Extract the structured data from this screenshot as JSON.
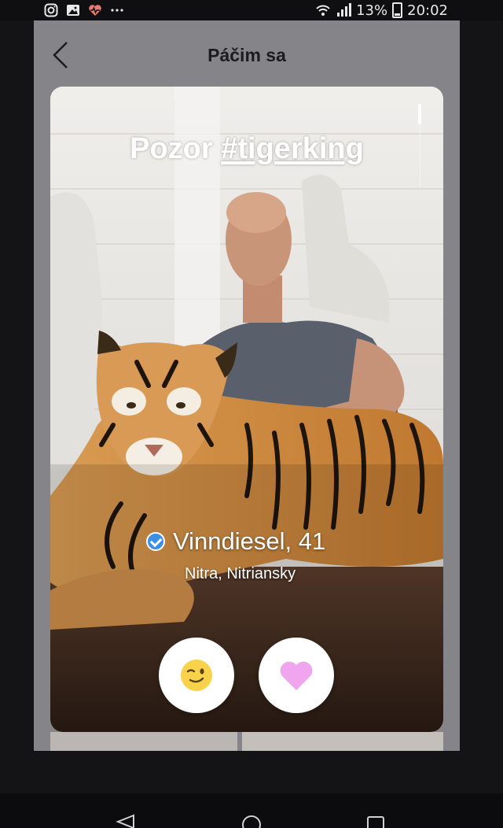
{
  "status_bar": {
    "left_icons": [
      "instagram-icon",
      "gallery-icon",
      "health-heart-icon",
      "more-dots-icon"
    ],
    "battery": "13%",
    "time": "20:02"
  },
  "header": {
    "back_icon": "chevron-left-icon",
    "title": "Páčim sa"
  },
  "profile_card": {
    "caption_prefix": "Pozor ",
    "caption_tag": "#tigerking",
    "name": "Vinndiesel, 41",
    "location": "Nitra, Nitriansky",
    "verified": true
  },
  "actions": {
    "wink_icon": "winking-face-icon",
    "like_icon": "heart-icon",
    "like_color": "#f0a6ef"
  },
  "nav": {
    "icons": [
      "back-triangle-icon",
      "home-circle-icon",
      "recents-square-icon"
    ]
  },
  "colors": {
    "app_background": "#858488",
    "status_bar": "#0f0e10",
    "verified_badge": "#3b8fe5"
  }
}
